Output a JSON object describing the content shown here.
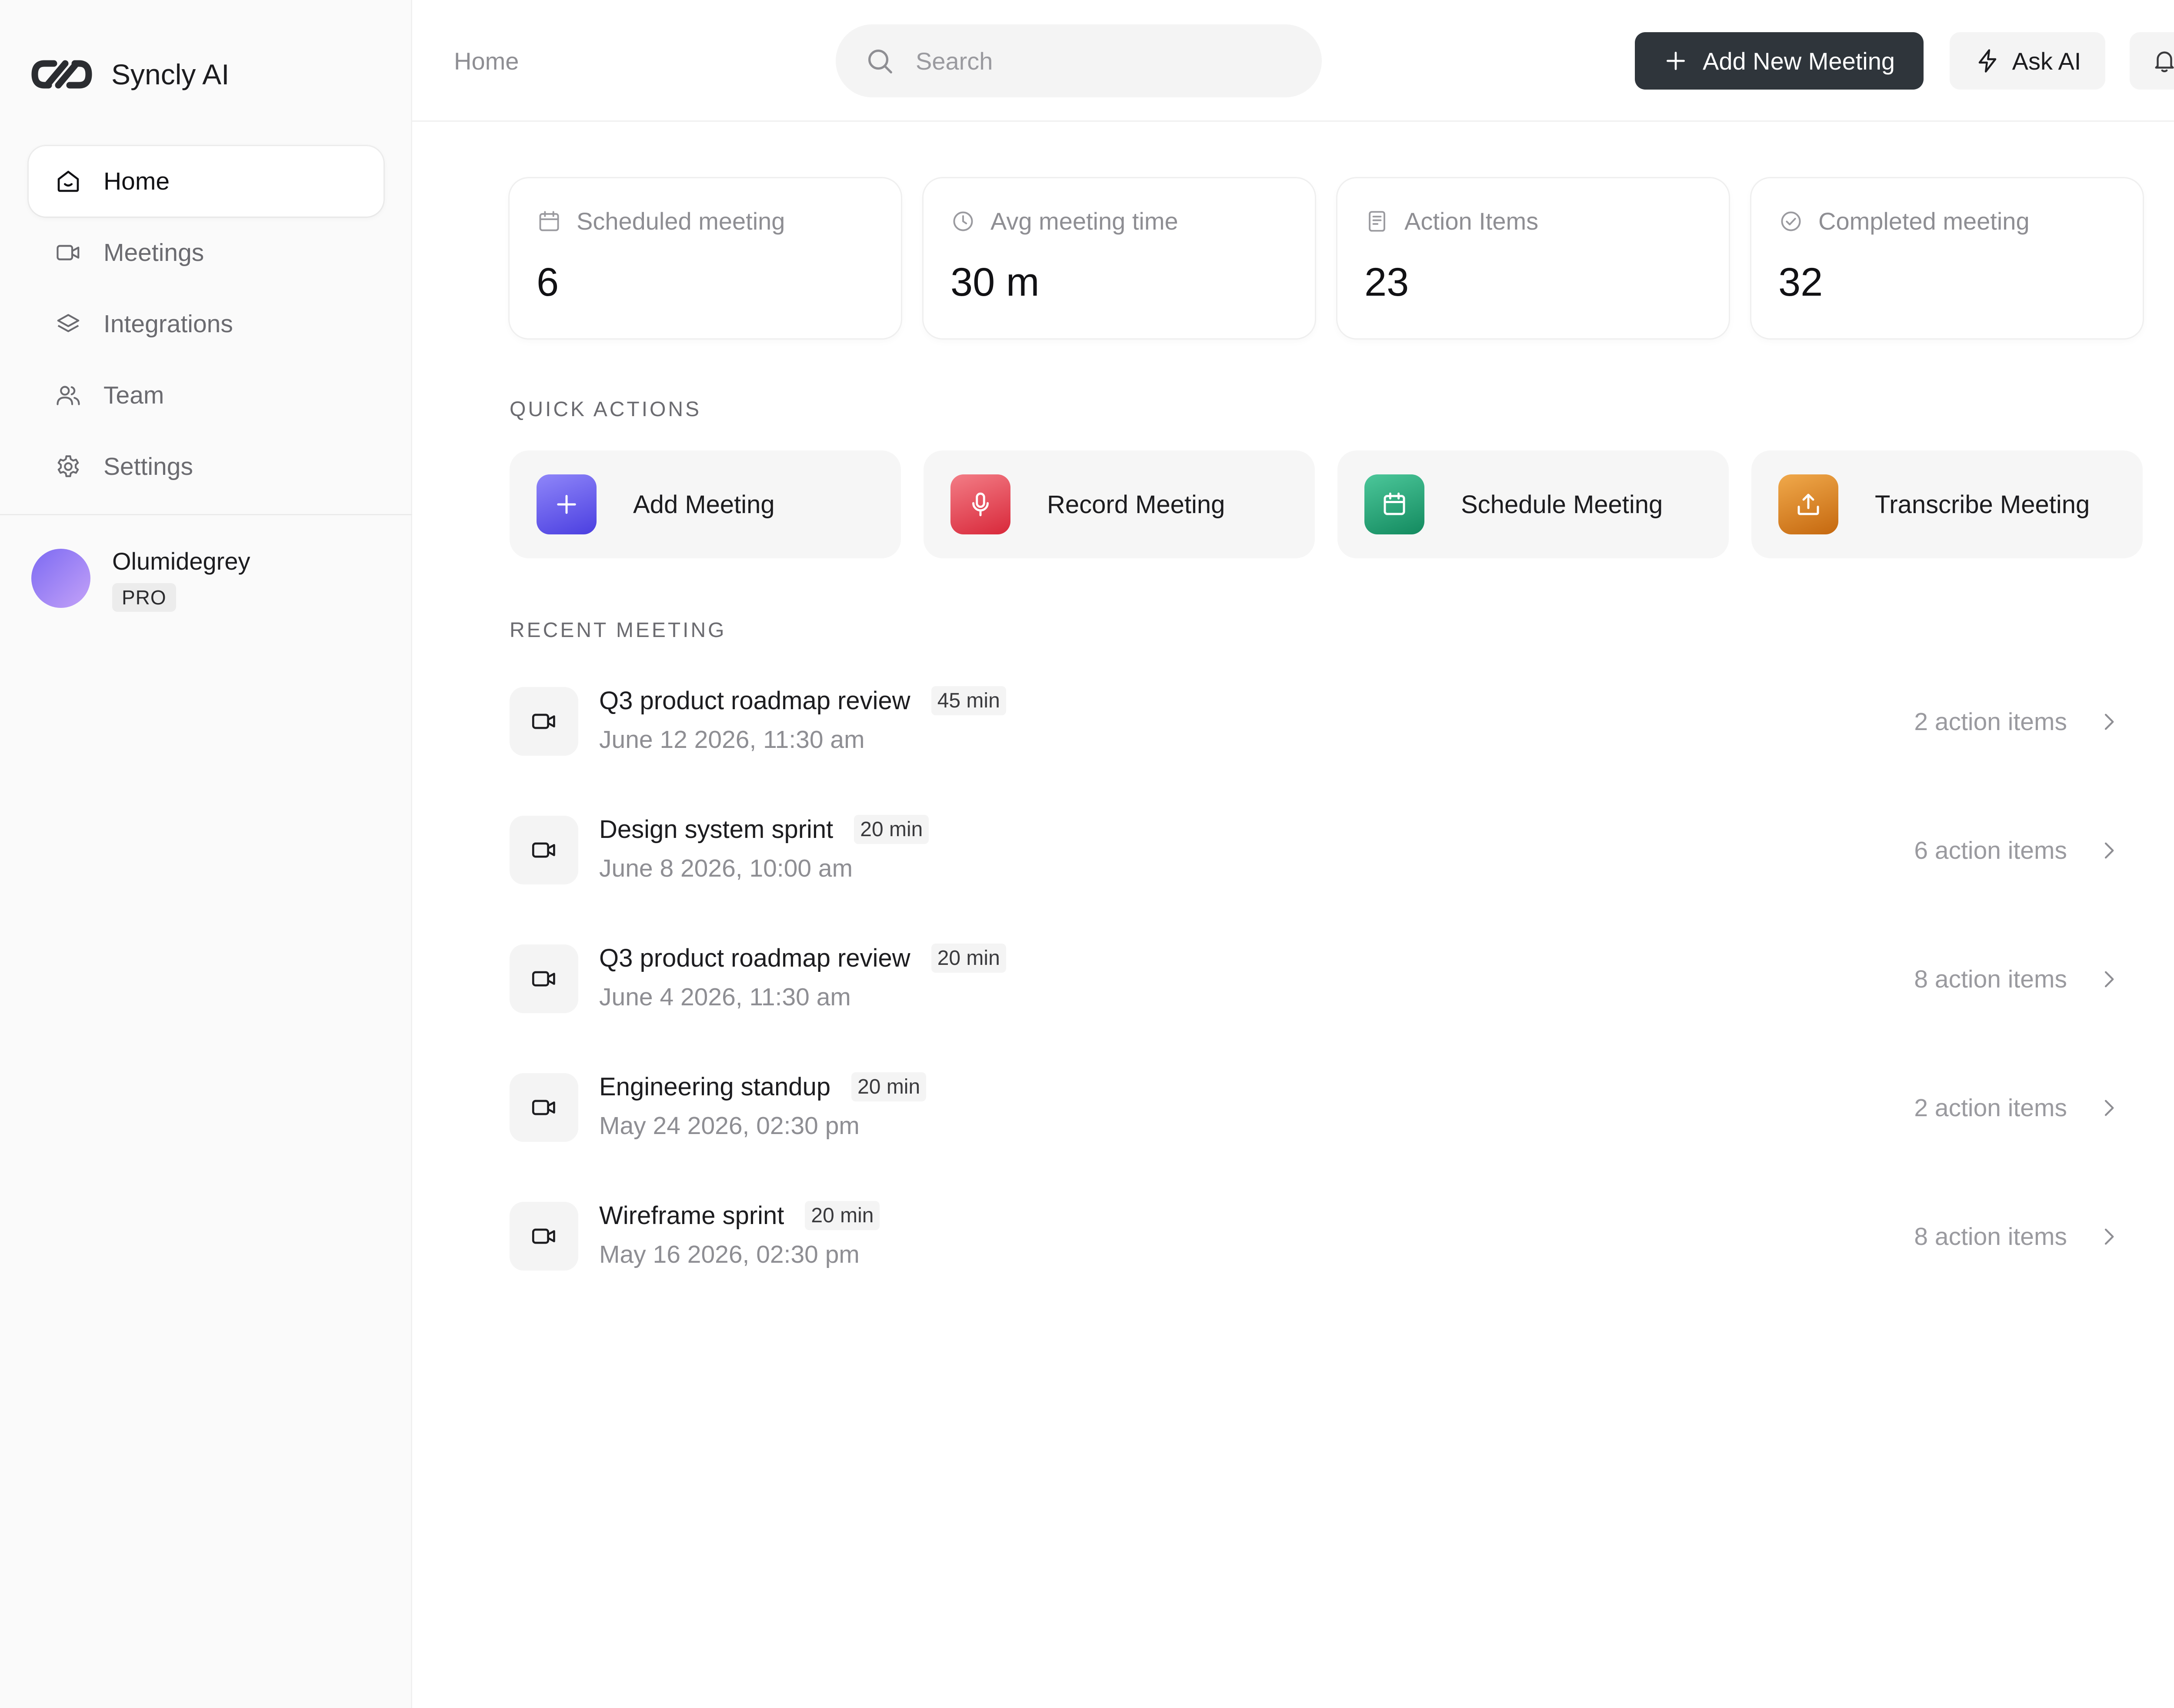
{
  "brand": {
    "name": "Syncly AI"
  },
  "sidebar": {
    "items": [
      {
        "label": "Home",
        "icon": "home-icon",
        "active": true
      },
      {
        "label": "Meetings",
        "icon": "video-icon",
        "active": false
      },
      {
        "label": "Integrations",
        "icon": "layers-icon",
        "active": false
      },
      {
        "label": "Team",
        "icon": "users-icon",
        "active": false
      },
      {
        "label": "Settings",
        "icon": "gear-icon",
        "active": false
      }
    ]
  },
  "profile": {
    "name": "Olumidegrey",
    "plan": "PRO"
  },
  "header": {
    "breadcrumb": "Home",
    "search_placeholder": "Search",
    "add_meeting_label": "Add New Meeting",
    "ask_ai_label": "Ask AI"
  },
  "stats": [
    {
      "label": "Scheduled meeting",
      "value": "6",
      "icon": "calendar-icon"
    },
    {
      "label": "Avg meeting time",
      "value": "30 m",
      "icon": "clock-icon"
    },
    {
      "label": "Action Items",
      "value": "23",
      "icon": "document-icon"
    },
    {
      "label": "Completed meeting",
      "value": "32",
      "icon": "check-circle-icon"
    }
  ],
  "quick_actions": {
    "title": "QUICK ACTIONS",
    "items": [
      {
        "label": "Add Meeting",
        "icon": "plus-icon",
        "color": "#5b4de8"
      },
      {
        "label": "Record Meeting",
        "icon": "microphone-icon",
        "color": "#e0424a"
      },
      {
        "label": "Schedule Meeting",
        "icon": "calendar-icon",
        "color": "#1f9a6e"
      },
      {
        "label": "Transcribe Meeting",
        "icon": "upload-icon",
        "color": "#d17a1f"
      }
    ]
  },
  "recent": {
    "title": "RECENT MEETING",
    "meetings": [
      {
        "title": "Q3 product roadmap review",
        "duration": "45 min",
        "date": "June 12 2026, 11:30 am",
        "action_items": "2 action items"
      },
      {
        "title": "Design system sprint",
        "duration": "20 min",
        "date": "June 8 2026, 10:00 am",
        "action_items": "6 action items"
      },
      {
        "title": "Q3 product roadmap review",
        "duration": "20 min",
        "date": "June 4 2026, 11:30 am",
        "action_items": "8 action items"
      },
      {
        "title": "Engineering standup",
        "duration": "20 min",
        "date": "May 24 2026, 02:30 pm",
        "action_items": "2 action items"
      },
      {
        "title": "Wireframe sprint",
        "duration": "20 min",
        "date": "May 16 2026, 02:30 pm",
        "action_items": "8 action items"
      }
    ]
  }
}
